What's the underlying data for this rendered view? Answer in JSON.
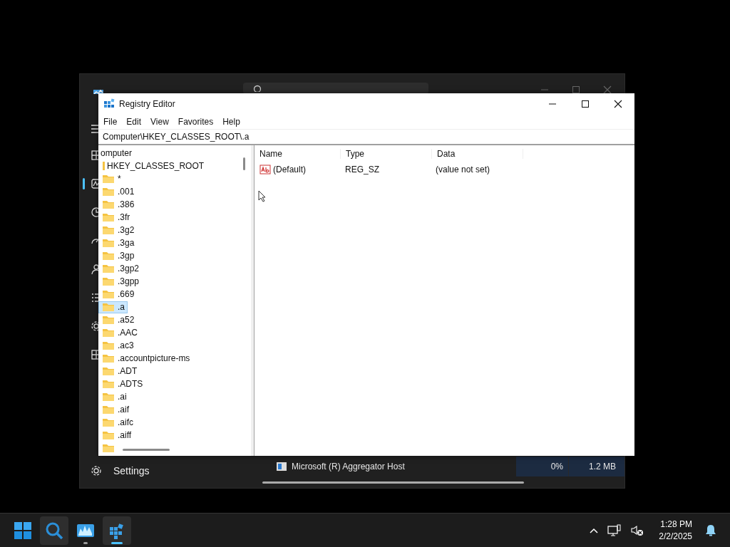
{
  "task_manager": {
    "nav_items": [
      {
        "selected": false
      },
      {
        "selected": true
      },
      {
        "selected": false
      },
      {
        "selected": false
      },
      {
        "selected": false
      },
      {
        "selected": false
      },
      {
        "selected": false
      },
      {
        "selected": false
      }
    ],
    "settings": "Settings",
    "process_row": {
      "name": "Microsoft (R) Aggregator Host",
      "cpu": "0%",
      "memory": "1.2 MB"
    }
  },
  "registry_editor": {
    "title": "Registry Editor",
    "menu": [
      "File",
      "Edit",
      "View",
      "Favorites",
      "Help"
    ],
    "address": "Computer\\HKEY_CLASSES_ROOT\\.a",
    "tree": [
      {
        "label": "omputer",
        "selected": false,
        "children": [
          {
            "label": "HKEY_CLASSES_ROOT",
            "selected": false,
            "children": [
              {
                "label": "*",
                "selected": false
              },
              {
                "label": ".001",
                "selected": false
              },
              {
                "label": ".386",
                "selected": false
              },
              {
                "label": ".3fr",
                "selected": false
              },
              {
                "label": ".3g2",
                "selected": false
              },
              {
                "label": ".3ga",
                "selected": false
              },
              {
                "label": ".3gp",
                "selected": false
              },
              {
                "label": ".3gp2",
                "selected": false
              },
              {
                "label": ".3gpp",
                "selected": false
              },
              {
                "label": ".669",
                "selected": false
              },
              {
                "label": ".a",
                "selected": true
              },
              {
                "label": ".a52",
                "selected": false
              },
              {
                "label": ".AAC",
                "selected": false
              },
              {
                "label": ".ac3",
                "selected": false
              },
              {
                "label": ".accountpicture-ms",
                "selected": false
              },
              {
                "label": ".ADT",
                "selected": false
              },
              {
                "label": ".ADTS",
                "selected": false
              },
              {
                "label": ".ai",
                "selected": false
              },
              {
                "label": ".aif",
                "selected": false
              },
              {
                "label": ".aifc",
                "selected": false
              },
              {
                "label": ".aiff",
                "selected": false
              }
            ]
          }
        ]
      }
    ],
    "columns": [
      "Name",
      "Type",
      "Data"
    ],
    "values": [
      {
        "name": "(Default)",
        "type": "REG_SZ",
        "data": "(value not set)"
      }
    ]
  },
  "taskbar": {
    "apps": [
      {
        "kind": "start",
        "selected": false,
        "running": false
      },
      {
        "kind": "search",
        "selected": true,
        "running": false
      },
      {
        "kind": "monitor",
        "selected": false,
        "running": true
      },
      {
        "kind": "registry",
        "selected": true,
        "running": true
      }
    ],
    "clock": {
      "time": "1:28 PM",
      "date": "2/2/2025"
    }
  }
}
